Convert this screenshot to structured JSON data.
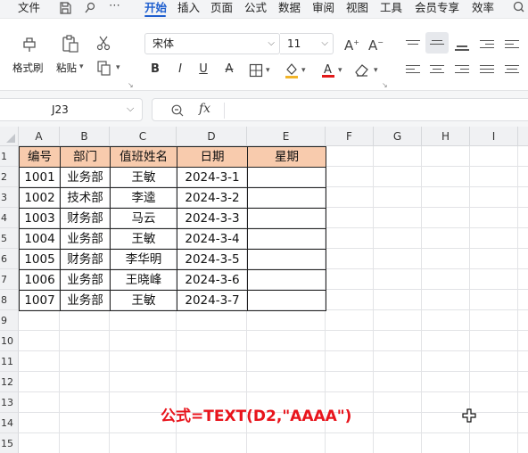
{
  "menubar": {
    "file": "文件",
    "tabs": [
      "开始",
      "插入",
      "页面",
      "公式",
      "数据",
      "审阅",
      "视图",
      "工具",
      "会员专享",
      "效率"
    ],
    "active_tab": "开始"
  },
  "ribbon": {
    "format_painter": "格式刷",
    "paste": "粘贴",
    "font_name": "宋体",
    "font_size": "11",
    "bold": "B",
    "italic": "I",
    "underline": "U",
    "strike": "A",
    "increase_font": "A",
    "decrease_font": "A"
  },
  "formula_bar": {
    "name_box": "J23",
    "fx": "fx",
    "content": ""
  },
  "sheet": {
    "columns": [
      "A",
      "B",
      "C",
      "D",
      "E",
      "F",
      "G",
      "H",
      "I"
    ],
    "rows": [
      "1",
      "2",
      "3",
      "4",
      "5",
      "6",
      "7",
      "8",
      "9",
      "10",
      "11",
      "12",
      "13",
      "14",
      "15",
      "16"
    ],
    "table_header": [
      "编号",
      "部门",
      "值班姓名",
      "日期",
      "星期"
    ],
    "table_rows": [
      [
        "1001",
        "业务部",
        "王敏",
        "2024-3-1",
        ""
      ],
      [
        "1002",
        "技术部",
        "李逵",
        "2024-3-2",
        ""
      ],
      [
        "1003",
        "财务部",
        "马云",
        "2024-3-3",
        ""
      ],
      [
        "1004",
        "业务部",
        "王敏",
        "2024-3-4",
        ""
      ],
      [
        "1005",
        "财务部",
        "李华明",
        "2024-3-5",
        ""
      ],
      [
        "1006",
        "业务部",
        "王晓峰",
        "2024-3-6",
        ""
      ],
      [
        "1007",
        "业务部",
        "王敏",
        "2024-3-7",
        ""
      ]
    ],
    "header_fill": "#f8cbad"
  },
  "annotation": {
    "formula_text": "公式=TEXT(D2,\"AAAA\")",
    "color": "#e8141c"
  }
}
